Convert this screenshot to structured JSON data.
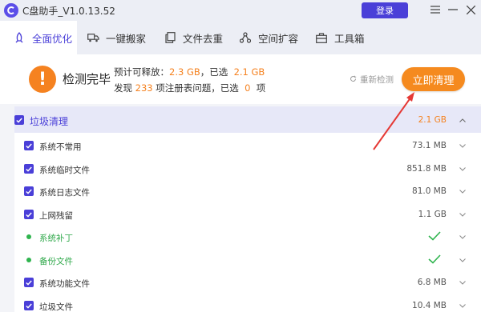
{
  "app": {
    "title": "C盘助手_V1.0.13.52",
    "login_label": "登录"
  },
  "tabs": [
    {
      "label": "全面优化",
      "icon": "rocket-icon",
      "active": true
    },
    {
      "label": "一键搬家",
      "icon": "truck-icon",
      "active": false
    },
    {
      "label": "文件去重",
      "icon": "file-copy-icon",
      "active": false
    },
    {
      "label": "空间扩容",
      "icon": "expand-icon",
      "active": false
    },
    {
      "label": "工具箱",
      "icon": "toolbox-icon",
      "active": false
    }
  ],
  "summary": {
    "status": "检测完毕",
    "line1_prefix": "预计可释放：",
    "line1_value": "2.3 GB",
    "line1_mid": "，已选",
    "line1_selected": "2.1 GB",
    "line2_prefix": "发现",
    "line2_count": "233",
    "line2_mid": "项注册表问题，已选",
    "line2_selected": "0",
    "line2_suffix": "项",
    "rescan_label": "重新检测",
    "clean_label": "立即清理"
  },
  "group": {
    "label": "垃圾清理",
    "size": "2.1 GB",
    "checked": true
  },
  "items": [
    {
      "label": "系统不常用",
      "size": "73.1 MB",
      "kind": "checkbox"
    },
    {
      "label": "系统临时文件",
      "size": "851.8 MB",
      "kind": "checkbox"
    },
    {
      "label": "系统日志文件",
      "size": "81.0 MB",
      "kind": "checkbox"
    },
    {
      "label": "上网残留",
      "size": "1.1 GB",
      "kind": "checkbox"
    },
    {
      "label": "系统补丁",
      "size": "",
      "kind": "ok"
    },
    {
      "label": "备份文件",
      "size": "",
      "kind": "ok"
    },
    {
      "label": "系统功能文件",
      "size": "6.8 MB",
      "kind": "checkbox"
    },
    {
      "label": "垃圾文件",
      "size": "10.4 MB",
      "kind": "checkbox"
    }
  ],
  "colors": {
    "accent": "#4a3fd8",
    "orange": "#f58a1f",
    "green": "#2fb44e",
    "arrow": "#e53935"
  }
}
